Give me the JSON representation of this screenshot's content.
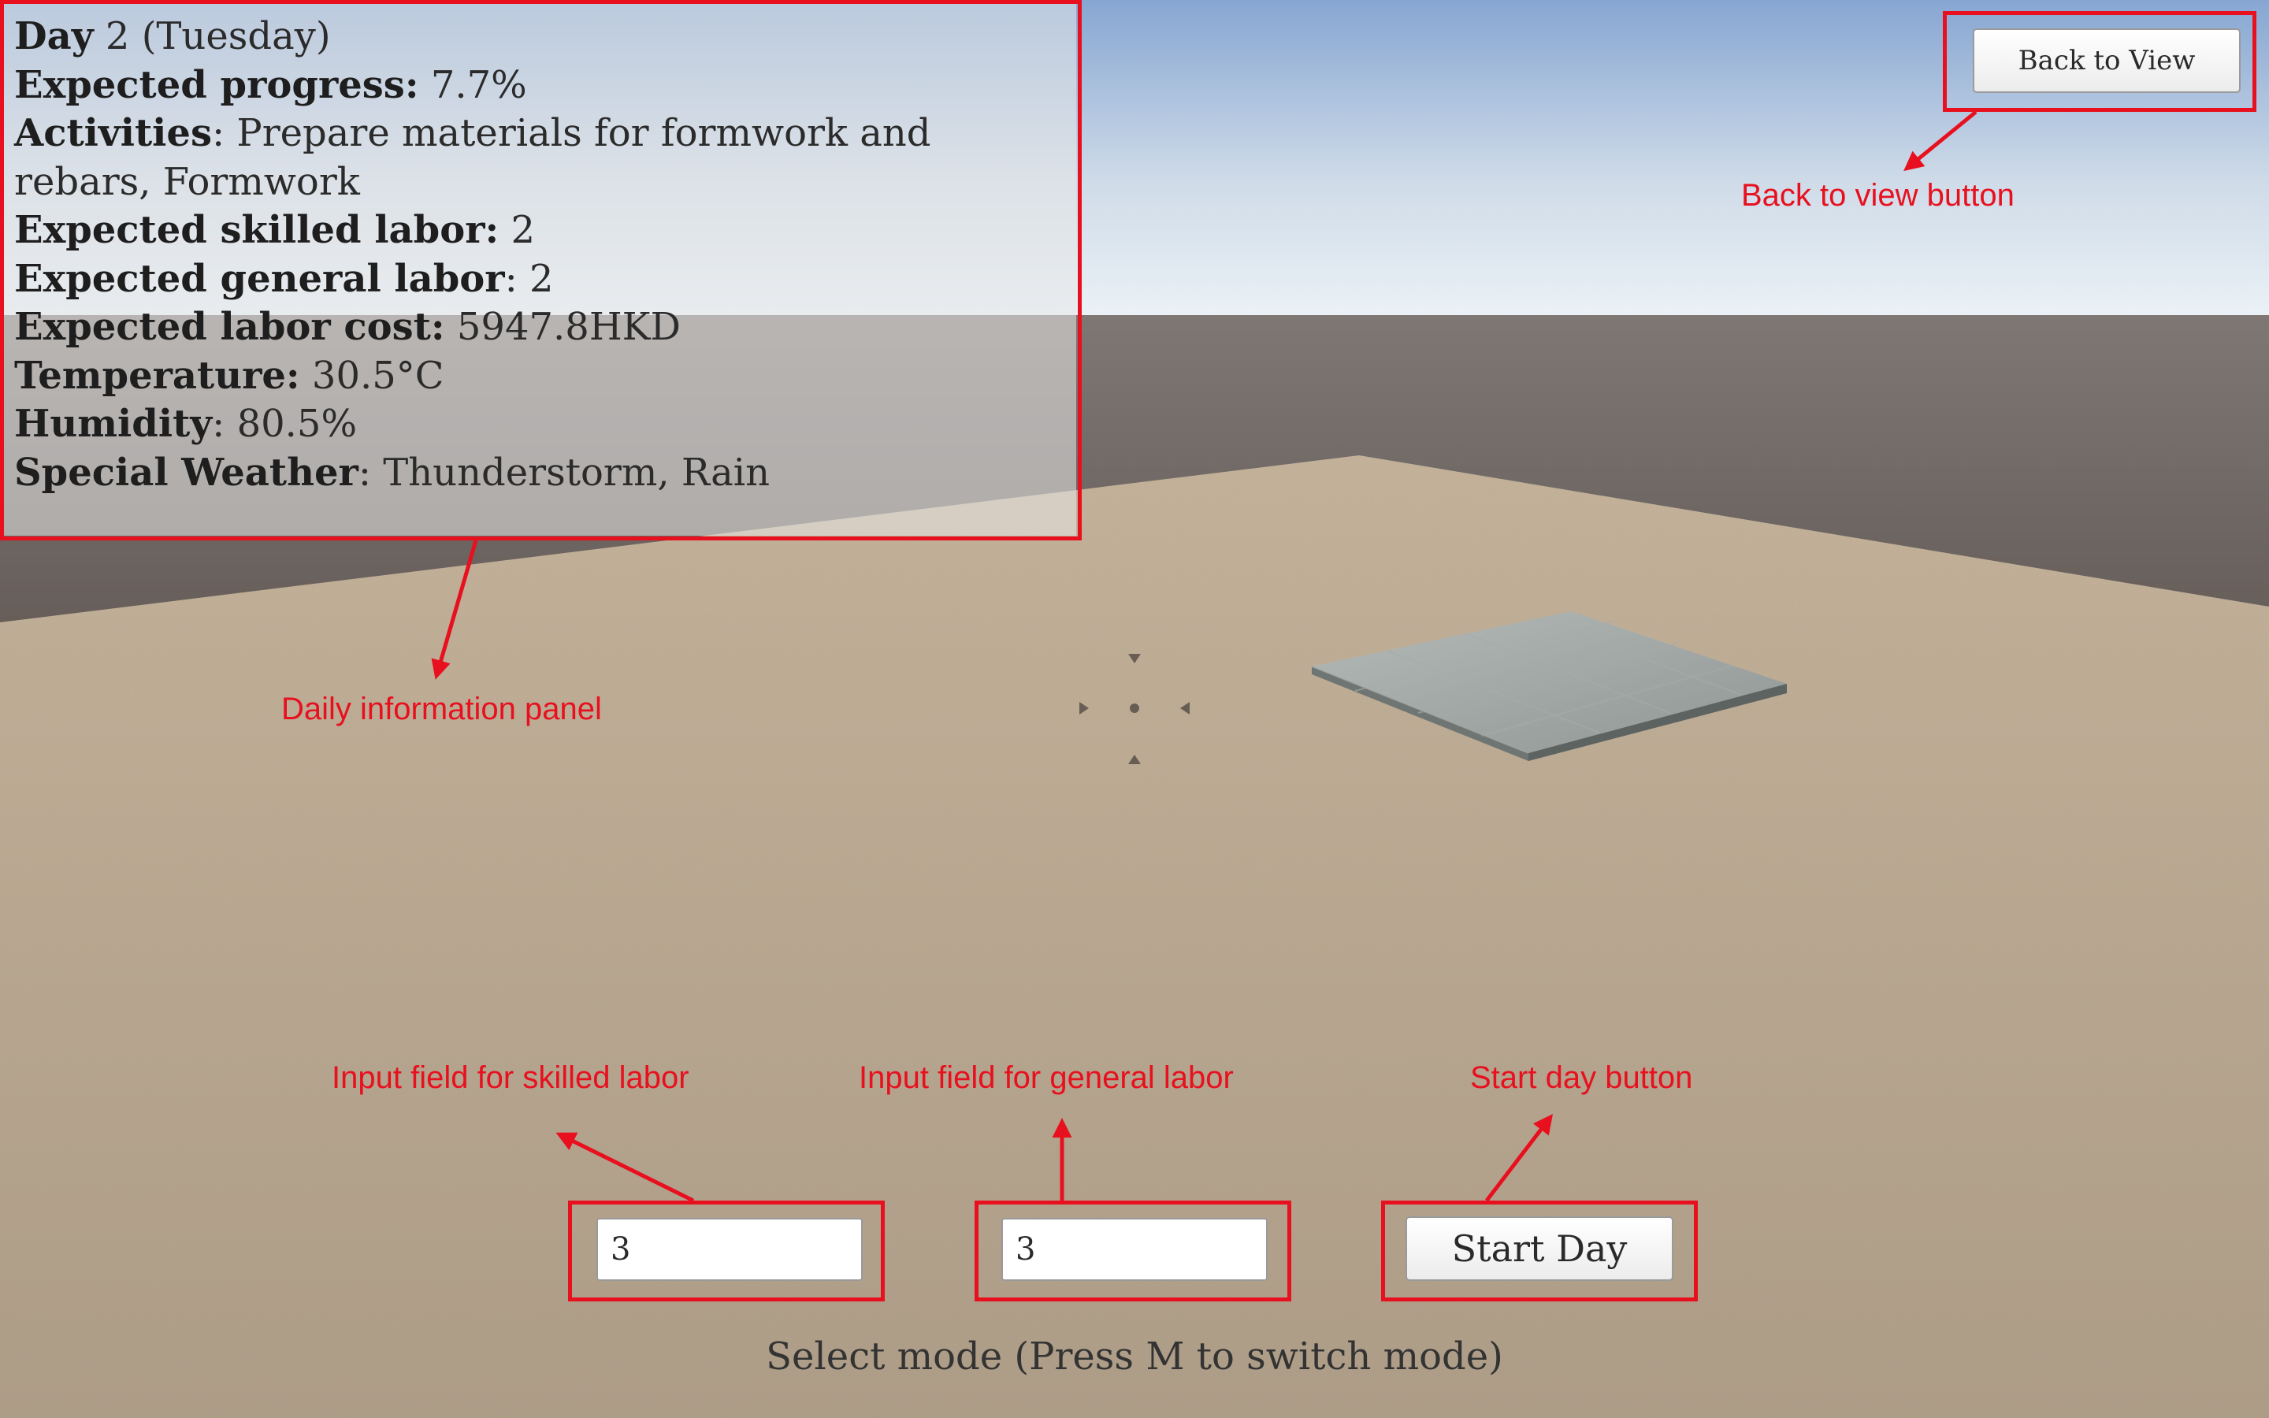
{
  "info_panel": {
    "day": {
      "label": "Day",
      "value": "2 (Tuesday)"
    },
    "expected_progress": {
      "label": "Expected progress:",
      "value": "7.7%"
    },
    "activities": {
      "label": "Activities",
      "value": ": Prepare materials for formwork and rebars, Formwork"
    },
    "expected_skilled_labor": {
      "label": "Expected skilled labor:",
      "value": "2"
    },
    "expected_general_labor": {
      "label": "Expected general labor",
      "value": ": 2"
    },
    "expected_labor_cost": {
      "label": "Expected labor cost:",
      "value": "5947.8HKD"
    },
    "temperature": {
      "label": "Temperature:",
      "value": "30.5°C"
    },
    "humidity": {
      "label": "Humidity",
      "value": ": 80.5%"
    },
    "special_weather": {
      "label": "Special Weather",
      "value": ": Thunderstorm, Rain"
    }
  },
  "buttons": {
    "back_to_view": "Back to View",
    "start_day": "Start Day"
  },
  "inputs": {
    "skilled_labor_value": "3",
    "general_labor_value": "3"
  },
  "status": {
    "mode_text": "Select mode (Press M to switch mode)"
  },
  "annotations": {
    "daily_panel": "Daily information panel",
    "back_to_view": "Back to view button",
    "skilled_input": "Input field for skilled labor",
    "general_input": "Input field for general labor",
    "start_day": "Start day button"
  },
  "colors": {
    "annotation": "#e8101e",
    "sky_top": "#8aaad4",
    "ground": "#b8a690"
  },
  "icons": [
    "crosshair-icon"
  ]
}
